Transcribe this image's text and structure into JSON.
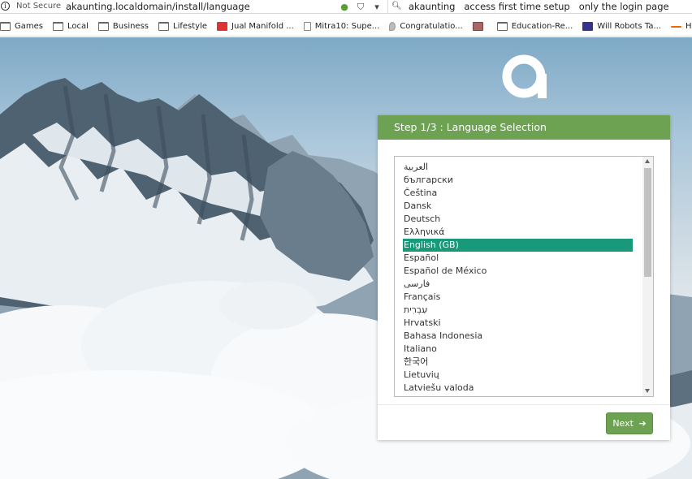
{
  "browser": {
    "security_label": "Not Secure",
    "url": "akaunting.localdomain/install/language",
    "search_query": "akaunting   access first time setup   only the login page"
  },
  "bookmarks": [
    {
      "label": "Games",
      "icon": "folder-icon"
    },
    {
      "label": "Local",
      "icon": "folder-icon"
    },
    {
      "label": "Business",
      "icon": "folder-icon"
    },
    {
      "label": "Lifestyle",
      "icon": "folder-icon"
    },
    {
      "label": "Jual Manifold ...",
      "icon": "bl-logo-icon"
    },
    {
      "label": "Mitra10: Supe...",
      "icon": "document-icon"
    },
    {
      "label": "Congratulatio...",
      "icon": "drop-icon"
    },
    {
      "label": "",
      "icon": "photo-icon"
    },
    {
      "label": "Education-Re...",
      "icon": "folder-icon"
    },
    {
      "label": "Will Robots Ta...",
      "icon": "site-icon"
    },
    {
      "label": "Home - We",
      "icon": "dash-icon"
    }
  ],
  "installer": {
    "step_title": "Step 1/3 : Language Selection",
    "selected_language": "English (GB)",
    "languages": [
      "العربية",
      "български",
      "Čeština",
      "Dansk",
      "Deutsch",
      "Ελληνικά",
      "English (GB)",
      "Español",
      "Español de México",
      "فارسی",
      "Français",
      "עִבְרִית",
      "Hrvatski",
      "Bahasa Indonesia",
      "Italiano",
      "한국어",
      "Lietuvių",
      "Latviešu valoda"
    ],
    "next_label": "Next"
  },
  "colors": {
    "header_green": "#6da252",
    "selected_teal": "#18997a"
  }
}
